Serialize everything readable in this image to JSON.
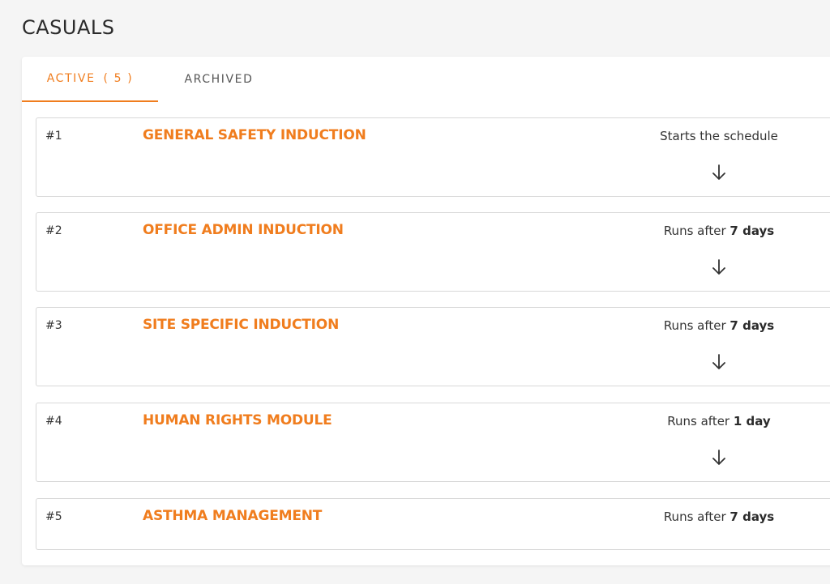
{
  "page": {
    "title": "CASUALS"
  },
  "tabs": {
    "active_label": "ACTIVE",
    "active_count": "( 5 )",
    "archived_label": "ARCHIVED"
  },
  "colors": {
    "accent": "#f07d1e",
    "border": "#d8d8d8",
    "background": "#f5f5f5"
  },
  "schedule": [
    {
      "num": "#1",
      "title": "GENERAL SAFETY INDUCTION",
      "status_prefix": "Starts the schedule",
      "status_value": "",
      "arrow": "arrow-down-icon"
    },
    {
      "num": "#2",
      "title": "OFFICE ADMIN INDUCTION",
      "status_prefix": "Runs after ",
      "status_value": "7 days",
      "arrow": "arrow-down-icon"
    },
    {
      "num": "#3",
      "title": "SITE SPECIFIC INDUCTION",
      "status_prefix": "Runs after ",
      "status_value": "7 days",
      "arrow": "arrow-down-icon"
    },
    {
      "num": "#4",
      "title": "HUMAN RIGHTS MODULE",
      "status_prefix": "Runs after ",
      "status_value": "1 day",
      "arrow": "arrow-down-icon"
    },
    {
      "num": "#5",
      "title": "ASTHMA MANAGEMENT",
      "status_prefix": "Runs after ",
      "status_value": "7 days",
      "arrow": ""
    }
  ]
}
